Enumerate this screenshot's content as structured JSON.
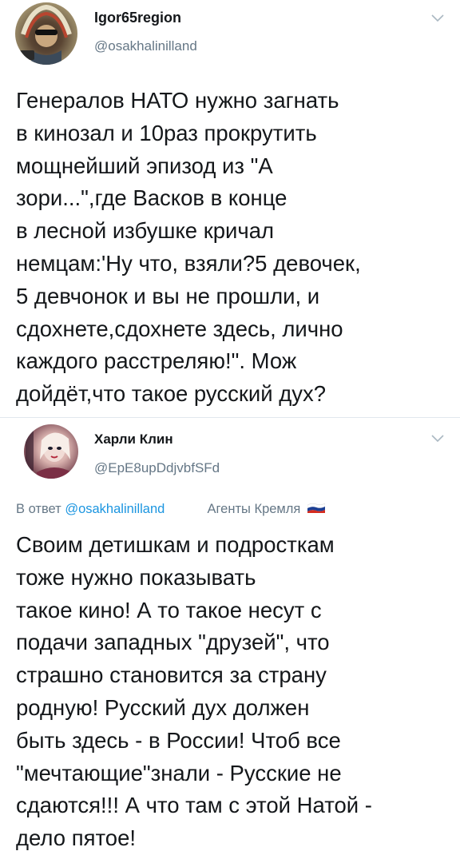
{
  "tweets": [
    {
      "author": {
        "display_name": "Igor65region",
        "handle": "@osakhalinilland",
        "avatar_icon": "avatar-native-headdress"
      },
      "text": "Генералов НАТО нужно загнать\nв кинозал и 10раз прокрутить\nмощнейший эпизод из \"А\nзори...\",где Васков в конце\nв лесной избушке кричал\nнемцам:'Ну что, взяли?5 девочек,\n5 девчонок и вы не прошли, и\nсдохнете,сдохнете здесь, лично\nкаждого расстреляю!\". Мож\nдойдёт,что такое русский дух?"
    },
    {
      "author": {
        "display_name": "Харли Клин",
        "handle": "@EpE8upDdjvbfSFd",
        "avatar_icon": "avatar-harley-portrait"
      },
      "reply": {
        "prefix": "В ответ",
        "mention": "@osakhalinilland",
        "bio_label": "Агенты Кремля",
        "flag_icon": "russian-flag-icon"
      },
      "text": "Своим детишкам и подросткам\nтоже нужно показывать\nтакое кино! А то такое несут с\nподачи западных \"друзей\", что\nстрашно становится за страну\nродную! Русский дух должен\nбыть здесь - в России! Чтоб все\n\"мечтающие\"знали - Русские не\nсдаются!!! А что там с этой Натой -\nдело пятое!"
    }
  ],
  "colors": {
    "text": "#14171a",
    "secondary": "#657786",
    "link": "#1b95e0",
    "divider": "#e1e8ed",
    "flag_white": "#ffffff",
    "flag_blue": "#1c3f94",
    "flag_red": "#d52b1e"
  }
}
